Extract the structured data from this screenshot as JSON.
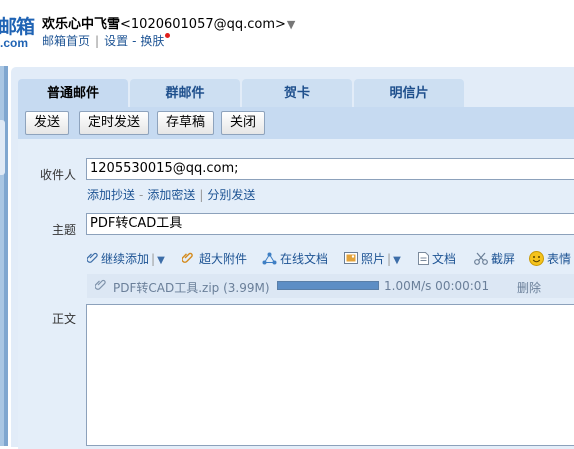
{
  "header": {
    "logo_main": "邮箱",
    "logo_sub": ".com",
    "user_name": "欢乐心中飞雪",
    "user_email": "<1020601057@qq.com>",
    "links": [
      "邮箱首页",
      "设置",
      "换肤"
    ]
  },
  "tabs": [
    {
      "label": "普通邮件",
      "active": true
    },
    {
      "label": "群邮件",
      "active": false
    },
    {
      "label": "贺卡",
      "active": false
    },
    {
      "label": "明信片",
      "active": false
    }
  ],
  "toolbar": {
    "send": "发送",
    "schedule": "定时发送",
    "draft": "存草稿",
    "close": "关闭"
  },
  "form": {
    "recipient_label": "收件人",
    "recipient_value": "1205530015@qq.com;",
    "cc_link": "添加抄送",
    "bcc_link": "添加密送",
    "separate_link": "分别发送",
    "subject_label": "主题",
    "subject_value": "PDF转CAD工具",
    "body_label": "正文"
  },
  "attach_toolbar": {
    "continue_add": "继续添加",
    "large_attach": "超大附件",
    "online_doc": "在线文档",
    "photo": "照片",
    "document": "文档",
    "screenshot": "截屏",
    "emoji": "表情"
  },
  "upload": {
    "filename": "PDF转CAD工具.zip (3.99M)",
    "progress": 1.0,
    "speed_time": "1.00M/s 00:00:01",
    "delete": "删除"
  },
  "colors": {
    "accent": "#1e5494",
    "panel": "#e2ecf8",
    "tab": "#cddff2",
    "notify": "#e0201c"
  }
}
